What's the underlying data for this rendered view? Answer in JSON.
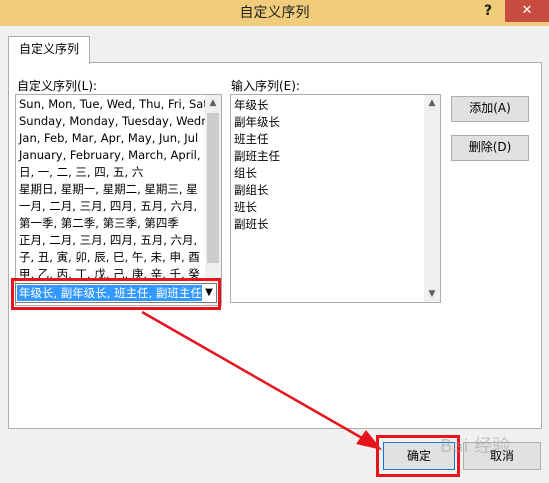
{
  "window": {
    "title": "自定义序列",
    "help_label": "?",
    "close_label": "✕"
  },
  "tab": {
    "label": "自定义序列"
  },
  "left_list": {
    "label": "自定义序列(L):",
    "items": [
      "Sun, Mon, Tue, Wed, Thu, Fri, Sat",
      "Sunday, Monday, Tuesday, Wednesday",
      "Jan, Feb, Mar, Apr, May, Jun, Jul",
      "January, February, March, April,",
      "日, 一, 二, 三, 四, 五, 六",
      "星期日, 星期一, 星期二, 星期三, 星",
      "一月, 二月, 三月, 四月, 五月, 六月,",
      "第一季, 第二季, 第三季, 第四季",
      "正月, 二月, 三月, 四月, 五月, 六月,",
      "子, 丑, 寅, 卯, 辰, 巳, 午, 未, 申, 酉",
      "甲, 乙, 丙, 丁, 戊, 己, 庚, 辛, 壬, 癸"
    ],
    "selected_item": "年级长, 副年级长, 班主任, 副班主任"
  },
  "right_list": {
    "label": "输入序列(E):",
    "items": [
      "年级长",
      "副年级长",
      "班主任",
      "副班主任",
      "组长",
      "副组长",
      "班长",
      "副班长"
    ]
  },
  "buttons": {
    "add": "添加(A)",
    "delete": "删除(D)",
    "ok": "确定",
    "cancel": "取消"
  },
  "watermark": "Bai 经验"
}
